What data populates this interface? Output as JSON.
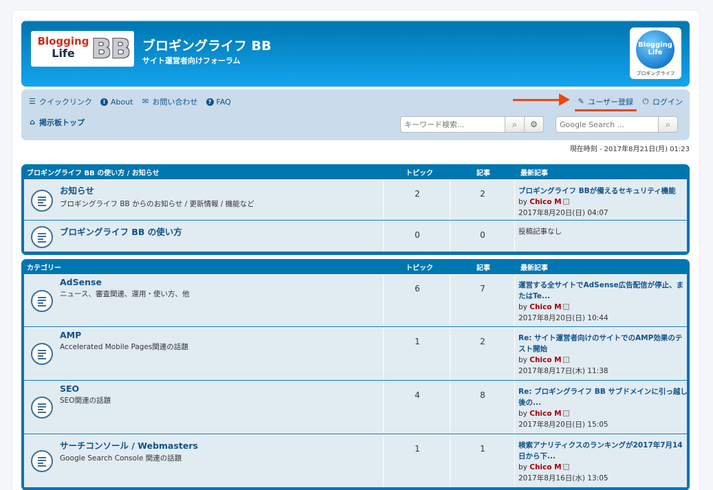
{
  "header": {
    "logo_line1": "Blogging",
    "logo_line2": "Life",
    "logo_bb": "BB",
    "site_title": "ブロギングライフ BB",
    "site_desc": "サイト運営者向けフォーラム",
    "badge_line1": "Blogging",
    "badge_line2": "Life",
    "badge_sub": "ブロギングライフ"
  },
  "nav": {
    "quicklinks": "クイックリンク",
    "about": "About",
    "contact": "お問い合わせ",
    "faq": "FAQ",
    "register": "ユーザー登録",
    "login": "ログイン",
    "breadcrumb": "掲示板トップ",
    "search_placeholder": "キーワード検索...",
    "google_placeholder": "Google Search ..."
  },
  "current_time": "現在時刻 - 2017年8月21日(月) 01:23",
  "categories": [
    {
      "header": {
        "name": "ブロギングライフ BB の使い方 / お知らせ",
        "topics": "トピック",
        "posts": "記事",
        "last": "最新記事"
      },
      "forums": [
        {
          "name": "お知らせ",
          "desc": "ブロギングライフ BB からのお知らせ / 更新情報 / 機能など",
          "topics": "2",
          "posts": "2",
          "last_title": "ブロギングライフ BBが備えるセキュリティ機能",
          "last_by": "by",
          "last_user": "Chico M",
          "last_date": "2017年8月20日(日) 04:07"
        },
        {
          "name": "ブロギングライフ BB の使い方",
          "desc": "",
          "topics": "0",
          "posts": "0",
          "last_none": "投稿記事なし"
        }
      ]
    },
    {
      "header": {
        "name": "カテゴリー",
        "topics": "トピック",
        "posts": "記事",
        "last": "最新記事"
      },
      "forums": [
        {
          "name": "AdSense",
          "desc": "ニュース、審査関連、運用・使い方、他",
          "topics": "6",
          "posts": "7",
          "last_title": "運営する全サイトでAdSense広告配信が停止、またはTe...",
          "last_by": "by",
          "last_user": "Chico M",
          "last_date": "2017年8月20日(日) 10:44"
        },
        {
          "name": "AMP",
          "desc": "Accelerated Mobile Pages関連の話題",
          "topics": "1",
          "posts": "2",
          "last_title": "Re: サイト運営者向けのサイトでのAMP効果のテスト開始",
          "last_by": "by",
          "last_user": "Chico M",
          "last_date": "2017年8月17日(木) 11:38"
        },
        {
          "name": "SEO",
          "desc": "SEO関連の話題",
          "topics": "4",
          "posts": "8",
          "last_title": "Re: ブロギングライフ BB サブドメインに引っ越し後の...",
          "last_by": "by",
          "last_user": "Chico M",
          "last_date": "2017年8月20日(日) 15:05"
        },
        {
          "name": "サーチコンソール / Webmasters",
          "desc": "Google Search Console 関連の話題",
          "topics": "1",
          "posts": "1",
          "last_title": "検索アナリティクスのランキングが2017年7月14日から下...",
          "last_by": "by",
          "last_user": "Chico M",
          "last_date": "2017年8月16日(水) 13:05"
        }
      ]
    }
  ]
}
